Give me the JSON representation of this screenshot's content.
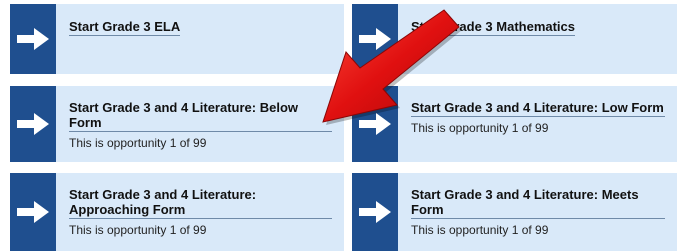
{
  "tiles": [
    {
      "title": "Start Grade 3 ELA",
      "subtitle": ""
    },
    {
      "title": "Start Grade 3 Mathematics",
      "subtitle": ""
    },
    {
      "title": "Start Grade 3 and 4 Literature: Below Form",
      "subtitle": "This is opportunity 1 of 99"
    },
    {
      "title": "Start Grade 3 and 4 Literature: Low Form",
      "subtitle": "This is opportunity 1 of 99"
    },
    {
      "title": "Start Grade 3 and 4 Literature: Approaching Form",
      "subtitle": "This is opportunity 1 of 99"
    },
    {
      "title": "Start Grade 3 and 4 Literature: Meets Form",
      "subtitle": "This is opportunity 1 of 99"
    }
  ],
  "colors": {
    "tile_bg": "#d9e9f9",
    "arrow_block": "#1f4f8f",
    "callout_arrow": "#e01010"
  },
  "icons": {
    "tile_arrow": "arrow-right-icon",
    "callout": "red-pointer-arrow-icon"
  }
}
